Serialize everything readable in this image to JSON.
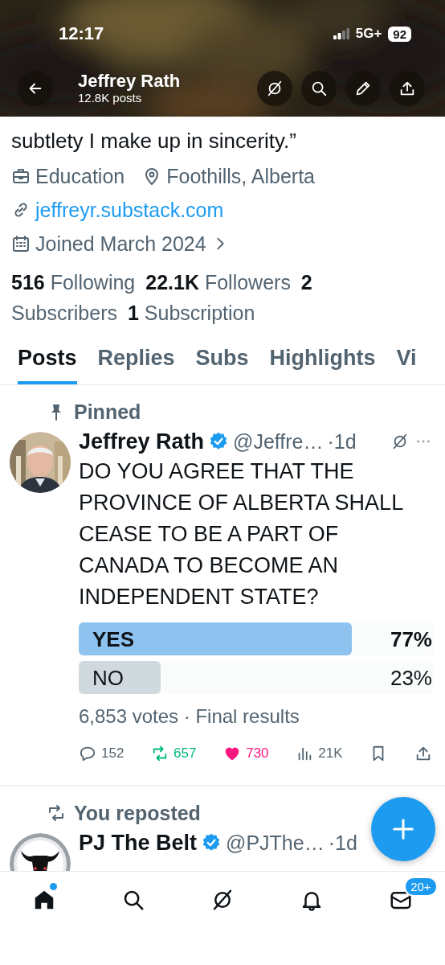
{
  "status_bar": {
    "time": "12:17",
    "network": "5G+",
    "battery": "92"
  },
  "header": {
    "title": "Jeffrey Rath",
    "subtitle": "12.8K posts"
  },
  "bio_tail": "subtlety I make up in sincerity.”",
  "profile_meta": [
    [
      {
        "kind": "category",
        "text": "Education"
      },
      {
        "kind": "location",
        "text": "Foothills, Alberta"
      }
    ],
    [
      {
        "kind": "link",
        "text": "jeffreyr.substack.com"
      }
    ],
    [
      {
        "kind": "joined",
        "text": "Joined March 2024"
      }
    ]
  ],
  "stats": [
    {
      "count": "516",
      "label": "Following"
    },
    {
      "count": "22.1K",
      "label": "Followers"
    },
    {
      "count": "2",
      "label": "Subscribers"
    },
    {
      "count": "1",
      "label": "Subscription"
    }
  ],
  "tabs": [
    {
      "label": "Posts",
      "selected": true
    },
    {
      "label": "Replies",
      "selected": false
    },
    {
      "label": "Subs",
      "selected": false
    },
    {
      "label": "Highlights",
      "selected": false
    },
    {
      "label": "Vi",
      "selected": false
    }
  ],
  "posts": [
    {
      "context": {
        "kind": "pinned",
        "text": "Pinned"
      },
      "author": "Jeffrey Rath",
      "verified": true,
      "handle": "@Jeffre…",
      "time": "·1d",
      "text": "DO YOU AGREE THAT THE PROVINCE OF ALBERTA SHALL CEASE TO BE A PART OF CANADA TO BECOME AN INDEPENDENT STATE?",
      "poll": {
        "options": [
          {
            "label": "YES",
            "percent": "77%",
            "level": 0.77,
            "winner": true
          },
          {
            "label": "NO",
            "percent": "23%",
            "level": 0.23,
            "winner": false
          }
        ],
        "footer": "6,853 votes · Final results"
      },
      "actions": [
        {
          "kind": "reply",
          "count": "152"
        },
        {
          "kind": "repost",
          "count": "657",
          "active": true
        },
        {
          "kind": "like",
          "count": "730",
          "active": true
        },
        {
          "kind": "views",
          "count": "21K"
        },
        {
          "kind": "bookmark"
        },
        {
          "kind": "share"
        }
      ]
    },
    {
      "context": {
        "kind": "repost",
        "text": "You reposted"
      },
      "author": "PJ The Belt",
      "verified": true,
      "handle": "@PJThe…",
      "time": "·1d"
    }
  ],
  "bottom_nav": [
    {
      "kind": "home",
      "selected": true,
      "has_new": true
    },
    {
      "kind": "search",
      "selected": false
    },
    {
      "kind": "grok",
      "selected": false
    },
    {
      "kind": "notifications",
      "selected": false
    },
    {
      "kind": "messages",
      "selected": false,
      "badge": "20+"
    }
  ]
}
